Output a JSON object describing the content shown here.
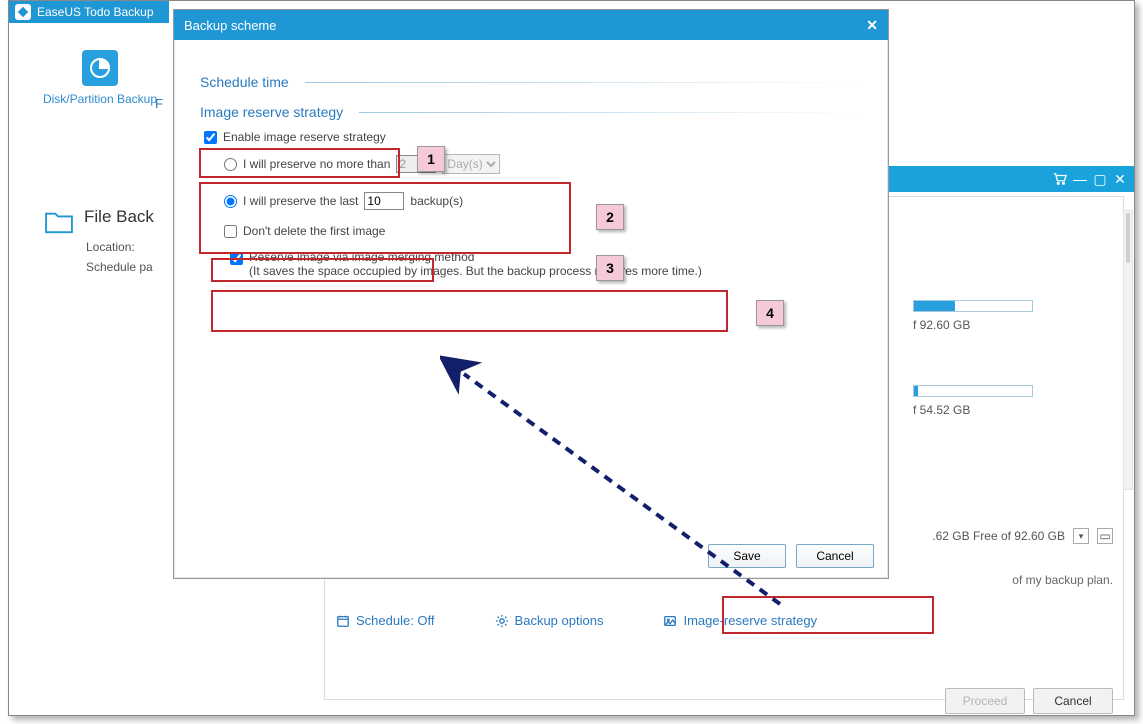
{
  "app_title": "EaseUS Todo Backup",
  "left_tile": {
    "label": "Disk/Partition Backup"
  },
  "bg": {
    "panel_title": "File Back",
    "location_label": "Location:",
    "schedule_label": "Schedule pa",
    "partial_letter": "F",
    "disk1": "f 92.60 GB",
    "disk2": "f 54.52 GB",
    "free_line": ".62 GB Free of 92.60 GB",
    "desc_text": "of my backup plan.",
    "proceed": "Proceed",
    "cancel": "Cancel"
  },
  "links": {
    "schedule": "Schedule: Off",
    "options": "Backup options",
    "strategy": "Image-reserve strategy"
  },
  "modal": {
    "title": "Backup scheme",
    "sec_schedule": "Schedule time",
    "sec_strategy": "Image reserve strategy",
    "cb_enable": "Enable image reserve strategy",
    "rb_preserve_no_more": "I will preserve no more than",
    "days_val": "2",
    "days_unit": "Day(s)",
    "rb_preserve_last": "I will preserve the last",
    "last_val": "10",
    "last_unit": "backup(s)",
    "cb_dont_delete": "Don't delete the first image",
    "cb_merge_l1": "Reserve image via image merging method",
    "cb_merge_l2": "(It saves the space occupied by images. But the backup process requires more time.)",
    "save": "Save",
    "cancel": "Cancel"
  },
  "badges": [
    "1",
    "2",
    "3",
    "4"
  ]
}
